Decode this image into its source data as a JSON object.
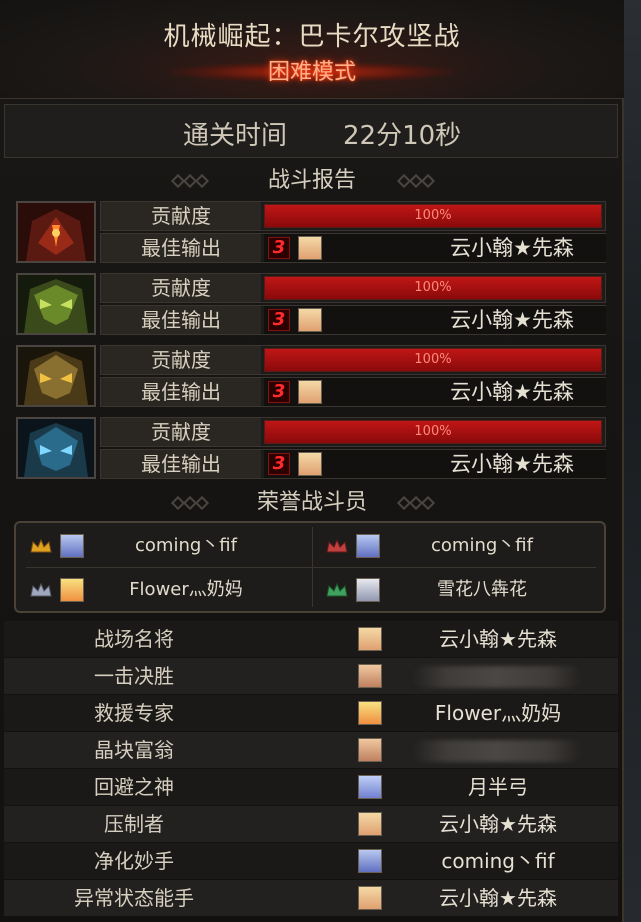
{
  "header": {
    "title": "机械崛起：巴卡尔攻坚战",
    "mode": "困难模式"
  },
  "clear_time": {
    "label": "通关时间",
    "value": "22分10秒"
  },
  "battle_report": {
    "title": "战斗报告",
    "bosses": [
      {
        "icon": "red-boss-icon",
        "contribution_label": "贡献度",
        "contribution": "100%",
        "contribution_fraction": 1.0,
        "best_output_label": "最佳输出",
        "rank": "3",
        "player": "云小翰★先森"
      },
      {
        "icon": "green-boss-icon",
        "contribution_label": "贡献度",
        "contribution": "100%",
        "contribution_fraction": 1.0,
        "best_output_label": "最佳输出",
        "rank": "3",
        "player": "云小翰★先森"
      },
      {
        "icon": "gold-boss-icon",
        "contribution_label": "贡献度",
        "contribution": "100%",
        "contribution_fraction": 1.0,
        "best_output_label": "最佳输出",
        "rank": "3",
        "player": "云小翰★先森"
      },
      {
        "icon": "blue-boss-icon",
        "contribution_label": "贡献度",
        "contribution": "100%",
        "contribution_fraction": 1.0,
        "best_output_label": "最佳输出",
        "rank": "3",
        "player": "云小翰★先森"
      }
    ]
  },
  "honor": {
    "title": "荣誉战斗员",
    "members": [
      {
        "name": "coming丶fif",
        "crown": "gold-crown-icon"
      },
      {
        "name": "coming丶fif",
        "crown": "red-crown-icon"
      },
      {
        "name": "Flower灬奶妈",
        "crown": "silver-crown-icon"
      },
      {
        "name": "雪花八犇花",
        "crown": "green-crown-icon"
      }
    ]
  },
  "awards": [
    {
      "title": "战场名将",
      "player": "云小翰★先森",
      "obscured": false
    },
    {
      "title": "一击决胜",
      "player": "",
      "obscured": true
    },
    {
      "title": "救援专家",
      "player": "Flower灬奶妈",
      "obscured": false
    },
    {
      "title": "晶块富翁",
      "player": "",
      "obscured": true
    },
    {
      "title": "回避之神",
      "player": "月半弓",
      "obscured": false
    },
    {
      "title": "压制者",
      "player": "云小翰★先森",
      "obscured": false
    },
    {
      "title": "净化妙手",
      "player": "coming丶fif",
      "obscured": false
    },
    {
      "title": "异常状态能手",
      "player": "云小翰★先森",
      "obscured": false
    }
  ],
  "colors": {
    "bar_red": "#c01616",
    "mode_glow": "#ff3a10",
    "rank_red": "#ff2a2a"
  }
}
